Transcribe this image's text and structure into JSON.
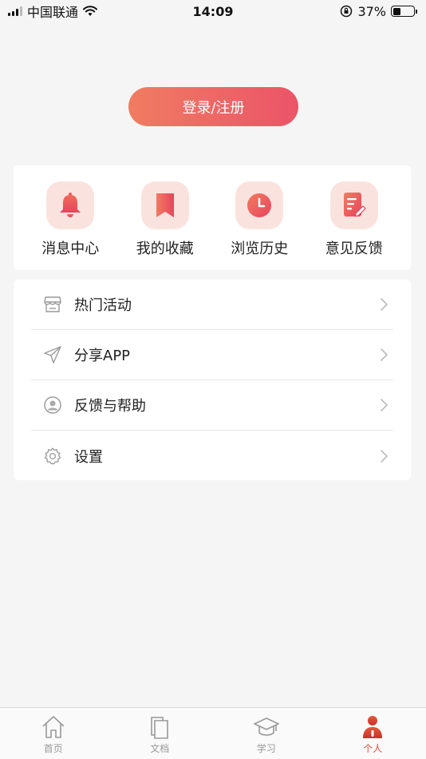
{
  "status_bar": {
    "carrier": "中国联通",
    "time": "14:09",
    "battery": "37%",
    "battery_level": 0.37
  },
  "login_button": {
    "label": "登录/注册"
  },
  "quick_actions": [
    {
      "label": "消息中心",
      "icon": "bell-icon"
    },
    {
      "label": "我的收藏",
      "icon": "bookmark-icon"
    },
    {
      "label": "浏览历史",
      "icon": "clock-icon"
    },
    {
      "label": "意见反馈",
      "icon": "feedback-icon"
    }
  ],
  "menu": [
    {
      "label": "热门活动",
      "icon": "store-icon"
    },
    {
      "label": "分享APP",
      "icon": "send-icon"
    },
    {
      "label": "反馈与帮助",
      "icon": "user-circle-icon"
    },
    {
      "label": "设置",
      "icon": "gear-icon"
    }
  ],
  "tabs": [
    {
      "label": "首页",
      "icon": "home-icon",
      "active": false
    },
    {
      "label": "文档",
      "icon": "documents-icon",
      "active": false
    },
    {
      "label": "学习",
      "icon": "graduation-cap-icon",
      "active": false
    },
    {
      "label": "个人",
      "icon": "person-icon",
      "active": true
    }
  ],
  "colors": {
    "accent": "#eb5468",
    "accent_start": "#f07c62",
    "icon_bg": "#fae3df",
    "background": "#f5f5f5"
  }
}
